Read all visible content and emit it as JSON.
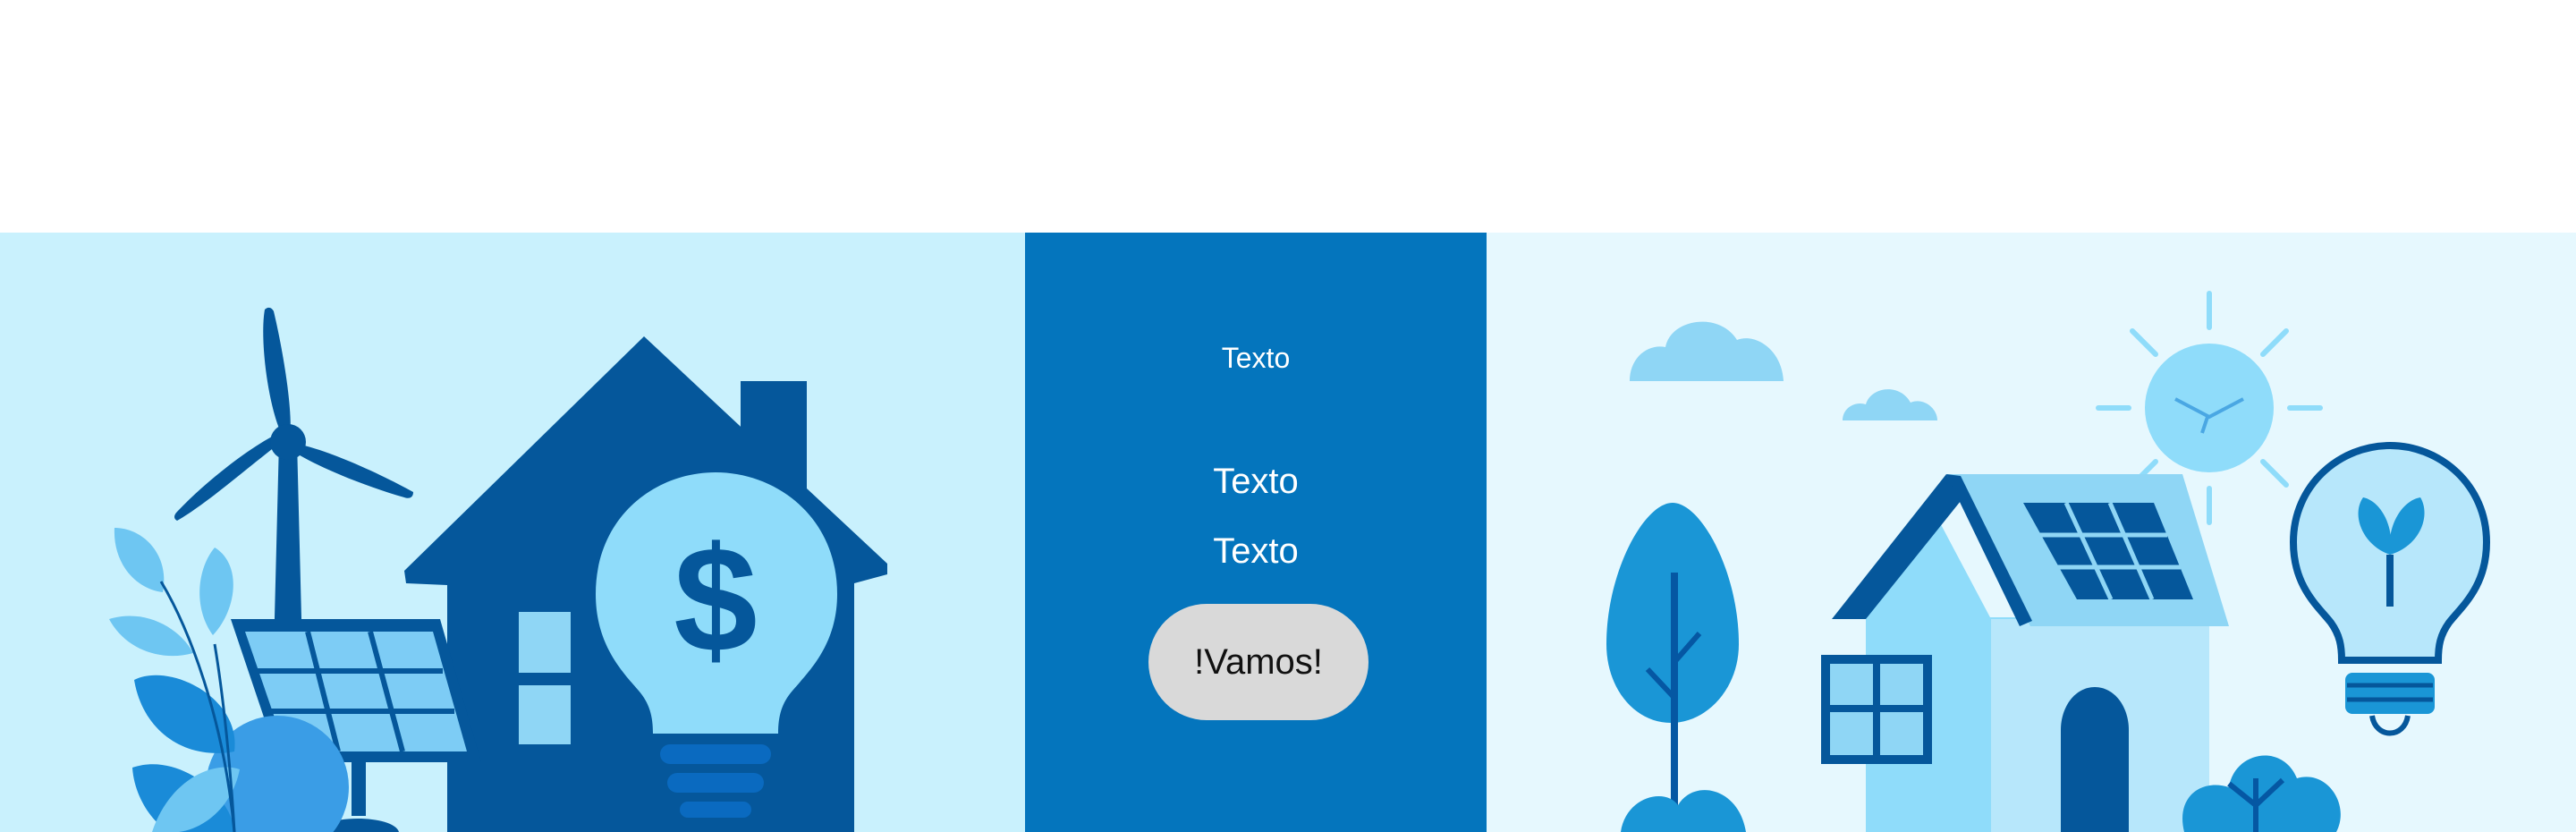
{
  "hero": {
    "center": {
      "text_small": "Texto",
      "text_1": "Texto",
      "text_2": "Texto",
      "button_label": "!Vamos!"
    }
  },
  "colors": {
    "left_bg": "#c9f1fd",
    "center_bg": "#0475bd",
    "right_bg": "#e6f8fe",
    "button_bg": "#d9d9d9"
  },
  "icons": {
    "left": [
      "wind-turbine-icon",
      "solar-panel-icon",
      "house-icon",
      "lightbulb-dollar-icon",
      "plant-icon"
    ],
    "right": [
      "cloud-icon",
      "sun-icon",
      "house-solar-icon",
      "tree-icon",
      "lightbulb-leaf-icon",
      "bush-icon"
    ]
  },
  "illustration_text": {
    "dollar_sign": "$"
  }
}
